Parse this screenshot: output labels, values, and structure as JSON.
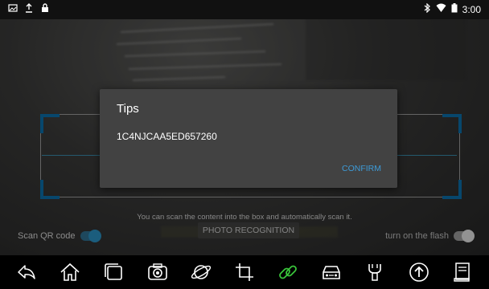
{
  "status_bar": {
    "time": "3:00",
    "left_icons": [
      "image-icon",
      "upload-icon",
      "lock-icon"
    ],
    "right_icons": [
      "bluetooth-icon",
      "wifi-icon",
      "battery-icon"
    ]
  },
  "scanner": {
    "hint": "You can scan the content into the box and automatically scan it.",
    "scan_qr_label": "Scan QR code",
    "flash_label": "turn on the flash",
    "photo_button": "PHOTO RECOGNITION",
    "accent_color": "#0b6da8"
  },
  "dialog": {
    "title": "Tips",
    "message": "1C4NJCAA5ED657260",
    "confirm_label": "CONFIRM",
    "confirm_color": "#3d9bd8"
  },
  "nav_bar": {
    "items": [
      "back-icon",
      "home-icon",
      "recent-apps-icon",
      "camera-icon",
      "browser-icon",
      "crop-icon",
      "link-icon",
      "car-icon",
      "diagnostic-tool-icon",
      "upload-arrow-icon",
      "manual-icon"
    ]
  }
}
